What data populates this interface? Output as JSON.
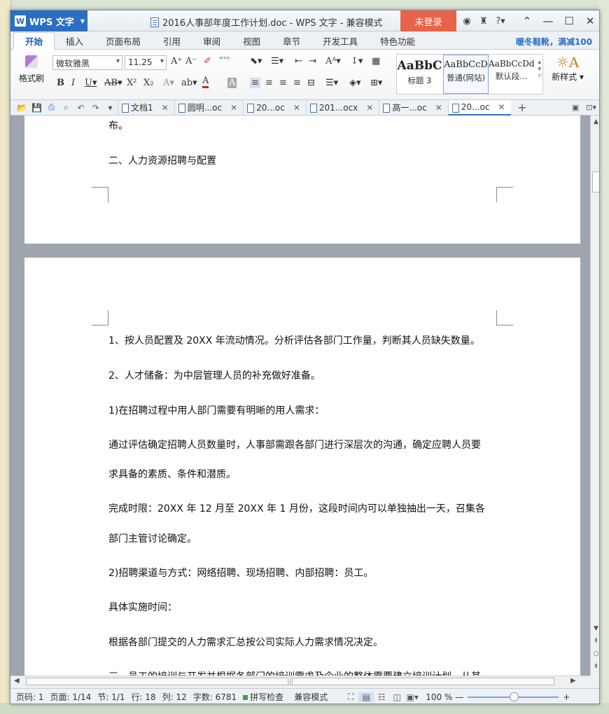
{
  "app": {
    "name": "WPS 文字",
    "logo_letter": "W",
    "window_title": "2016人事部年度工作计划.doc - WPS 文字 - 兼容模式",
    "login_label": "未登录",
    "promo": "暖冬鞋靴，满减100"
  },
  "ribbon_tabs": [
    "开始",
    "插入",
    "页面布局",
    "引用",
    "审阅",
    "视图",
    "章节",
    "开发工具",
    "特色功能"
  ],
  "ribbon": {
    "format_brush_label": "格式刷",
    "font_name": "微软雅黑",
    "font_size": "11.25",
    "styles": [
      {
        "sample": "AaBbC",
        "label": "标题 3"
      },
      {
        "sample": "AaBbCcD",
        "label": "普通(网站)"
      },
      {
        "sample": "AaBbCcDd",
        "label": "默认段..."
      }
    ],
    "new_style_label": "新样式"
  },
  "doc_tabs": [
    {
      "label": "文档1",
      "active": false
    },
    {
      "label": "圆明...oc",
      "active": false
    },
    {
      "label": "20...oc",
      "active": false
    },
    {
      "label": "201...ocx",
      "active": false
    },
    {
      "label": "高一...oc",
      "active": false
    },
    {
      "label": "20...oc",
      "active": true
    }
  ],
  "document": {
    "page1_lines": [
      "布。",
      "二、人力资源招聘与配置"
    ],
    "page2_lines": [
      "1、按人员配置及 20XX 年流动情况。分析评估各部门工作量，判断其人员缺失数量。",
      "2、人才储备：为中层管理人员的补充做好准备。",
      "1)在招聘过程中用人部门需要有明晰的用人需求：",
      "通过评估确定招聘人员数量时，人事部需跟各部门进行深层次的沟通，确定应聘人员要",
      "求具备的素质、条件和潜质。",
      "完成时限：20XX 年 12 月至 20XX 年 1 月份，这段时间内可以单独抽出一天，召集各",
      "部门主管讨论确定。",
      "2)招聘渠道与方式：网络招聘、现场招聘、内部招聘：员工。",
      "具体实施时间：",
      "根据各部门提交的人力需求汇总按公司实际人力需求情况决定。",
      "三、员工的培训与开发并根据各部门的培训需求及企业的整体需要建立培训计划，从其"
    ]
  },
  "status": {
    "page_code": "页码: 1",
    "page": "页面: 1/14",
    "section": "节: 1/1",
    "row": "行: 18",
    "col": "列: 12",
    "word_count": "字数: 6781",
    "spell_check": "拼写检查",
    "compat_mode": "兼容模式",
    "zoom": "100 %"
  }
}
